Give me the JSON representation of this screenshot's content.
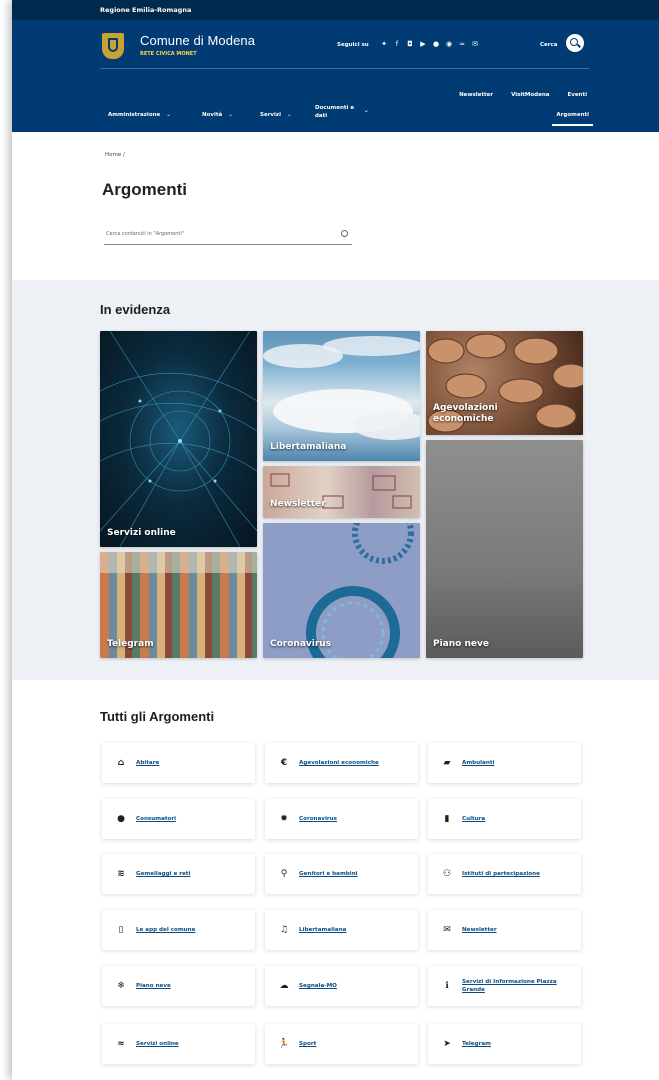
{
  "topbar": {
    "region": "Regione Emilia-Romagna"
  },
  "header": {
    "site_name": "Comune di Modena",
    "site_sub": "RETE CIVICA MONET",
    "seguici": "Seguici su",
    "search_label": "Cerca",
    "social_icons": [
      "twitter-icon",
      "facebook-icon",
      "instagram-icon",
      "youtube-icon",
      "telegram-icon",
      "whatsapp-icon",
      "rss-icon",
      "mail-icon"
    ]
  },
  "nav": {
    "secondary": [
      "Newsletter",
      "VisitModena",
      "Eventi"
    ],
    "primary": [
      "Amministrazione",
      "Novità",
      "Servizi",
      "Documenti e dati"
    ],
    "active": "Argomenti"
  },
  "breadcrumb": "Home /",
  "page_title": "Argomenti",
  "search": {
    "placeholder": "Cerca contenuti in \"Argomenti\""
  },
  "evidenza": {
    "title": "In evidenza",
    "cards": [
      "Servizi online",
      "Libertamaliana",
      "Newsletter",
      "Agevolazioni economiche",
      "Telegram",
      "Coronavirus",
      "Piano neve"
    ]
  },
  "tutti": {
    "title": "Tutti gli Argomenti",
    "items": [
      {
        "label": "Abitare",
        "icon": "home-icon"
      },
      {
        "label": "Agevolazioni economiche",
        "icon": "euro-icon"
      },
      {
        "label": "Ambulanti",
        "icon": "truck-icon"
      },
      {
        "label": "Consumatori",
        "icon": "apple-icon"
      },
      {
        "label": "Coronavirus",
        "icon": "virus-icon"
      },
      {
        "label": "Cultura",
        "icon": "book-icon"
      },
      {
        "label": "Gemellaggi e reti",
        "icon": "handshake-icon"
      },
      {
        "label": "Genitori e bambini",
        "icon": "child-icon"
      },
      {
        "label": "Istituti di partecipazione",
        "icon": "users-icon"
      },
      {
        "label": "Le app del comune",
        "icon": "mobile-icon"
      },
      {
        "label": "Libertamaliana",
        "icon": "music-icon"
      },
      {
        "label": "Newsletter",
        "icon": "envelope-icon"
      },
      {
        "label": "Piano neve",
        "icon": "snowflake-icon"
      },
      {
        "label": "Segnala-MO",
        "icon": "chat-icon"
      },
      {
        "label": "Servizi di Informazione Piazza Grande",
        "icon": "info-icon"
      },
      {
        "label": "Servizi online",
        "icon": "wifi-icon"
      },
      {
        "label": "Sport",
        "icon": "running-icon"
      },
      {
        "label": "Telegram",
        "icon": "paper-plane-icon"
      }
    ]
  }
}
